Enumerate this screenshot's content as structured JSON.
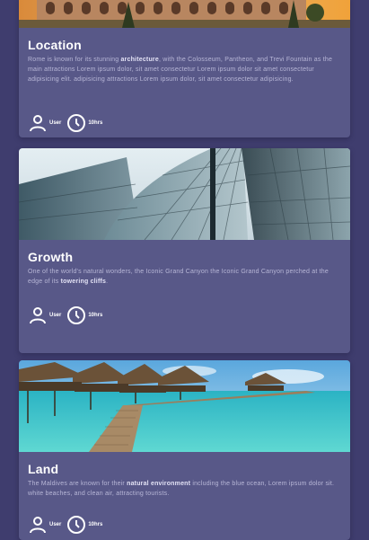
{
  "cards": [
    {
      "image_alt": "Colosseum",
      "title": "Location",
      "desc_pre": "Rome is known for its stunning ",
      "desc_bold": "architecture",
      "desc_post": ", with the Colosseum, Pantheon, and Trevi Fountain as the main attractions Lorem ipsum dolor, sit amet consectetur Lorem ipsum dolor sit amet consectetur adipisicing elit. adipisicing attractions Lorem ipsum dolor, sit amet consectetur adipisicing.",
      "user_label": "User",
      "time_label": "10hrs"
    },
    {
      "image_alt": "Glass skyscrapers",
      "title": "Growth",
      "desc_pre": "One of the world's natural wonders, the Iconic Grand Canyon the Iconic Grand Canyon perched at the edge of its ",
      "desc_bold": "towering cliffs",
      "desc_post": ".",
      "user_label": "User",
      "time_label": "10hrs"
    },
    {
      "image_alt": "Maldives overwater bungalows",
      "title": "Land",
      "desc_pre": "The Maldives are known for their ",
      "desc_bold": "natural environment",
      "desc_post": " including the blue ocean, Lorem ipsum dolor sit. white beaches, and clean air, attracting tourists.",
      "user_label": "User",
      "time_label": "10hrs"
    }
  ],
  "colors": {
    "background": "#3f3d6e",
    "card": "#585888",
    "title": "#ffffff",
    "text": "#b7b6d6"
  },
  "icons": [
    "user-icon",
    "clock-icon"
  ]
}
